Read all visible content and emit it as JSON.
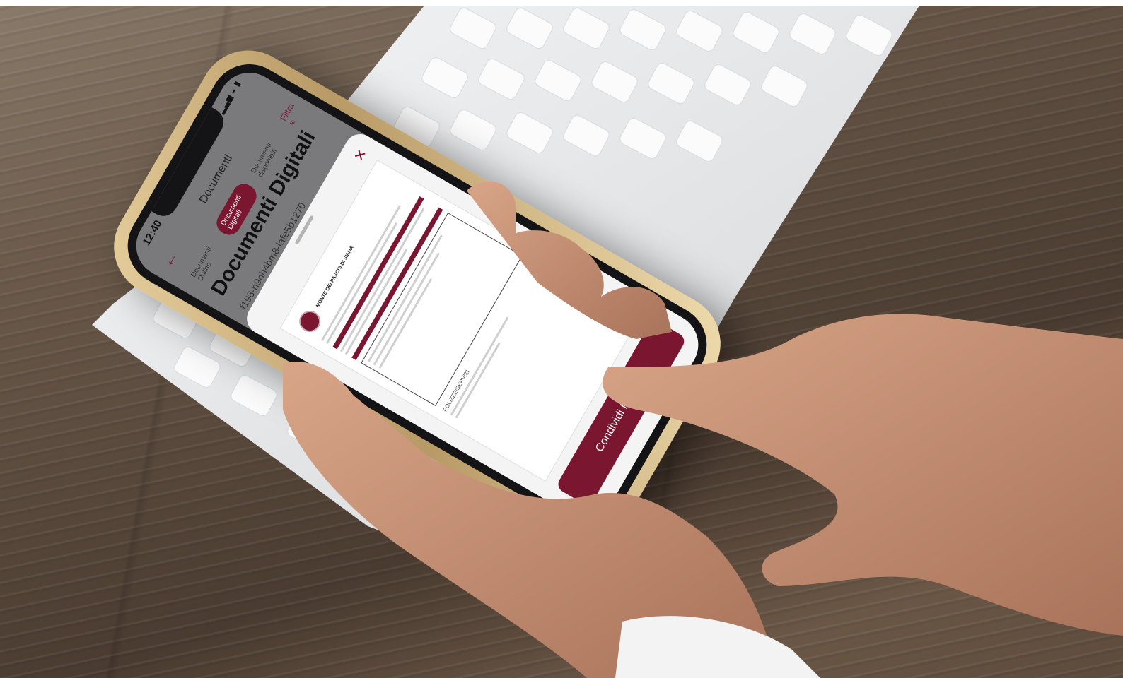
{
  "photo": {
    "colors": {
      "accent": "#7b1631",
      "wood": "#5a4a3d",
      "keyboard": "#e9eaec",
      "skin": "#c69074"
    }
  },
  "phone_app": {
    "status_time": "12:40",
    "title": "Documenti",
    "tabs": [
      "Documenti Online",
      "Documenti Digitali",
      "Documenti disponibili"
    ],
    "active_tab": 1,
    "filter_label": "Filtra",
    "page_title": "Documenti Digitali",
    "background_row": "f198-n9nh4bm8-lafe5b1270",
    "document": {
      "logo_text": "MONTE DEI PASCHI DI SIENA",
      "heading": "POLIZZE/SERVIZI"
    },
    "share_button": "Condividi PDF"
  }
}
